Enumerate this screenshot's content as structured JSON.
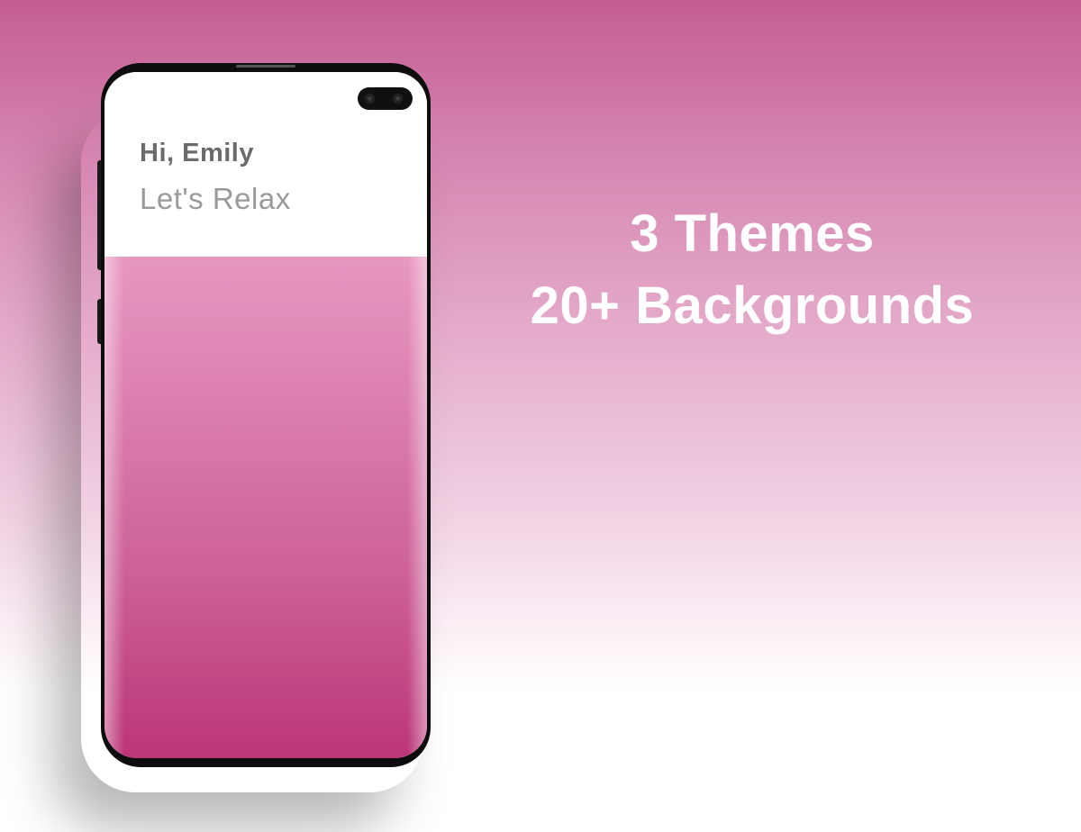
{
  "app": {
    "greeting": "Hi, Emily",
    "subtitle": "Let's Relax"
  },
  "promo": {
    "line1": "3 Themes",
    "line2": "20+ Backgrounds"
  },
  "colors": {
    "background_top": "#c45d93",
    "background_bottom": "#ffffff",
    "wallpaper_top": "#e797c1",
    "wallpaper_bottom": "#bb3578",
    "greeting_text": "#6b6b6b",
    "subtitle_text": "#9a9a9a",
    "promo_text": "#ffffff"
  }
}
